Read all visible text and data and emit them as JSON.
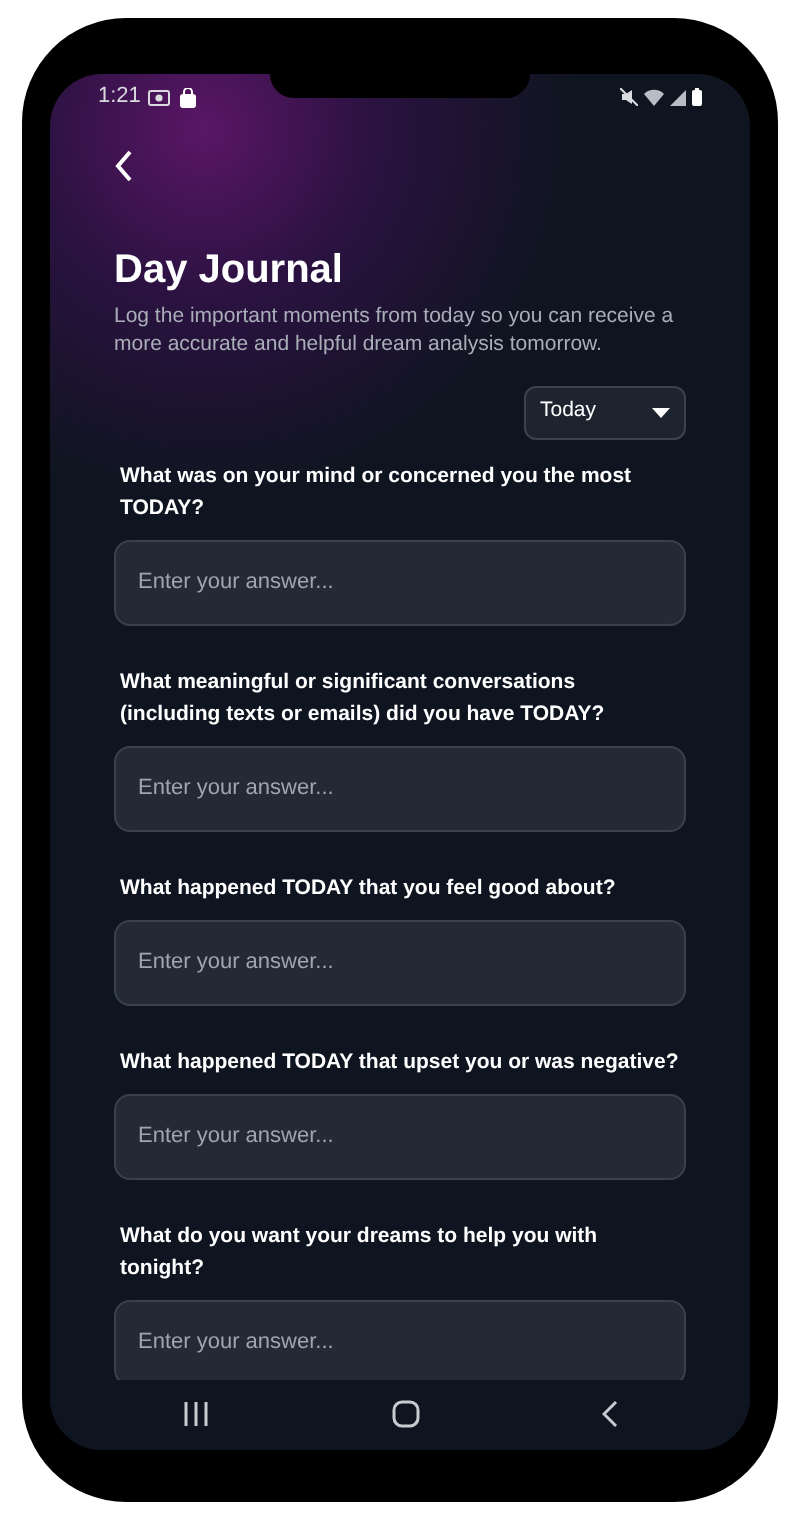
{
  "status_bar": {
    "time": "1:21"
  },
  "header": {
    "title": "Day Journal",
    "description": "Log the important moments from today so you can receive a more accurate and helpful dream analysis tomorrow."
  },
  "period_dropdown": {
    "value": "Today"
  },
  "questions": [
    {
      "label": "What was on your mind or concerned you the most TODAY?",
      "placeholder": "Enter your answer..."
    },
    {
      "label": "What meaningful or significant conversations (including texts or emails) did you have TODAY?",
      "placeholder": "Enter your answer..."
    },
    {
      "label": "What happened TODAY that you feel good about?",
      "placeholder": "Enter your answer..."
    },
    {
      "label": "What happened TODAY that upset you or was negative?",
      "placeholder": "Enter your answer..."
    },
    {
      "label": "What do you want your dreams to help you with tonight?",
      "placeholder": "Enter your answer..."
    }
  ]
}
